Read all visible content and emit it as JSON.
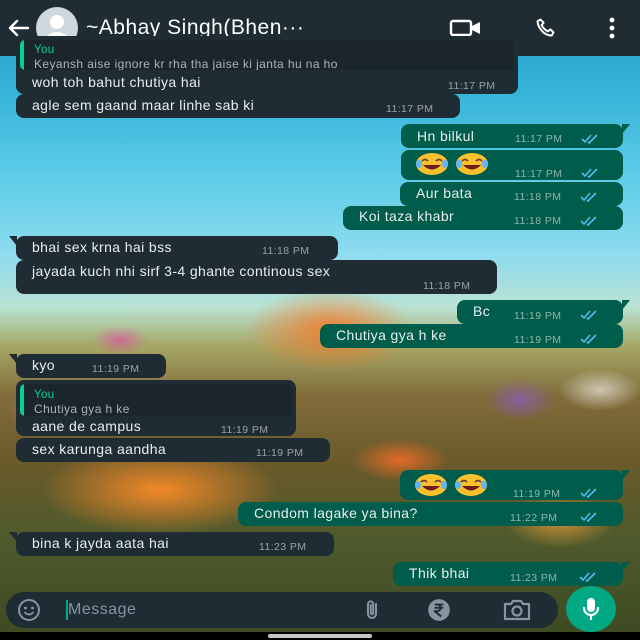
{
  "header": {
    "contact_name": "~Abhay Singh(Bhen···",
    "icons": [
      "back-arrow-icon",
      "avatar",
      "video-call-icon",
      "phone-icon",
      "more-vert-icon"
    ]
  },
  "messages": [
    {
      "dir": "in",
      "quote_author": "You",
      "quote_text": "Keyansh aise ignore kr rha tha jaise ki janta hu na ho",
      "text": "woh toh bahut chutiya hai",
      "time": "11:17 PM"
    },
    {
      "dir": "in",
      "text": "agle sem gaand maar linhe sab ki",
      "time": "11:17 PM"
    },
    {
      "dir": "out",
      "text": "Hn bilkul",
      "time": "11:17 PM",
      "read": true
    },
    {
      "dir": "out",
      "emoji": [
        "rofl-emoji",
        "rofl-emoji"
      ],
      "time": "11:17 PM",
      "read": true
    },
    {
      "dir": "out",
      "text": "Aur bata",
      "time": "11:18 PM",
      "read": true
    },
    {
      "dir": "out",
      "text": "Koi taza khabr",
      "time": "11:18 PM",
      "read": true
    },
    {
      "dir": "in",
      "text": "bhai sex krna hai bss",
      "time": "11:18 PM"
    },
    {
      "dir": "in",
      "text": "jayada kuch nhi sirf 3-4 ghante continous sex",
      "time": "11:18 PM"
    },
    {
      "dir": "out",
      "text": "Bc",
      "time": "11:19 PM",
      "read": true
    },
    {
      "dir": "out",
      "text": "Chutiya gya h ke",
      "time": "11:19 PM",
      "read": true
    },
    {
      "dir": "in",
      "text": "kyo",
      "time": "11:19 PM"
    },
    {
      "dir": "in",
      "quote_author": "You",
      "quote_text": "Chutiya gya h ke",
      "text": "aane de campus",
      "time": "11:19 PM"
    },
    {
      "dir": "in",
      "text": "sex karunga aandha",
      "time": "11:19 PM"
    },
    {
      "dir": "out",
      "emoji": [
        "rofl-emoji",
        "rofl-emoji"
      ],
      "time": "11:19 PM",
      "read": true
    },
    {
      "dir": "out",
      "text": "Condom lagake ya bina?",
      "time": "11:22 PM",
      "read": true
    },
    {
      "dir": "in",
      "text": "bina k jayda aata hai",
      "time": "11:23 PM"
    },
    {
      "dir": "out",
      "text": "Thik bhai",
      "time": "11:23 PM",
      "read": true
    }
  ],
  "input": {
    "placeholder": "Message",
    "icons": [
      "emoji-icon",
      "attach-icon",
      "rupee-payment-icon",
      "camera-icon",
      "mic-icon"
    ]
  },
  "colors": {
    "header_bg": "#1f2c34",
    "incoming_bubble": "#1f2c34",
    "outgoing_bubble": "#005c4b",
    "accent": "#00a884",
    "read_ticks": "#53bdeb",
    "quote_author": "#06cf9c"
  }
}
